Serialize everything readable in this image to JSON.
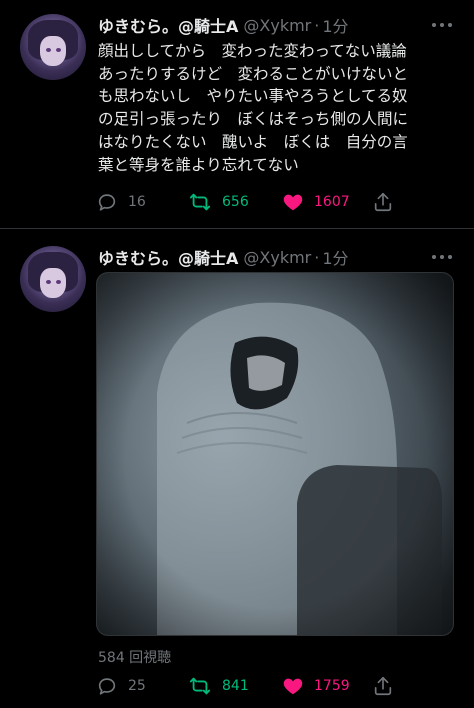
{
  "tweets": [
    {
      "display_name": "ゆきむら。@騎士A",
      "handle": "@Xykmr",
      "separator": "·",
      "time": "1分",
      "text_lines": [
        "顔出ししてから　変わった変わってない議論",
        "あったりするけど　変わることがいけないと",
        "も思わないし　やりたい事やろうとしてる奴",
        "の足引っ張ったり　ぼくはそっち側の人間に",
        "はなりたくない　醜いよ　ぼくは　自分の言",
        "葉と等身を誰より忘れてない"
      ],
      "replies": "16",
      "retweets": "656",
      "likes": "1607"
    },
    {
      "display_name": "ゆきむら。@騎士A",
      "handle": "@Xykmr",
      "separator": "·",
      "time": "1分",
      "views": "584 回視聴",
      "replies": "25",
      "retweets": "841",
      "likes": "1759"
    }
  ],
  "icons": {
    "reply": "reply-icon",
    "retweet": "retweet-icon",
    "like": "heart-icon",
    "share": "share-icon",
    "more": "more-icon"
  },
  "colors": {
    "background": "#000000",
    "text": "#e7e9ea",
    "muted": "#71767b",
    "retweet": "#00ba7c",
    "like": "#f91880",
    "divider": "#2f3336"
  }
}
